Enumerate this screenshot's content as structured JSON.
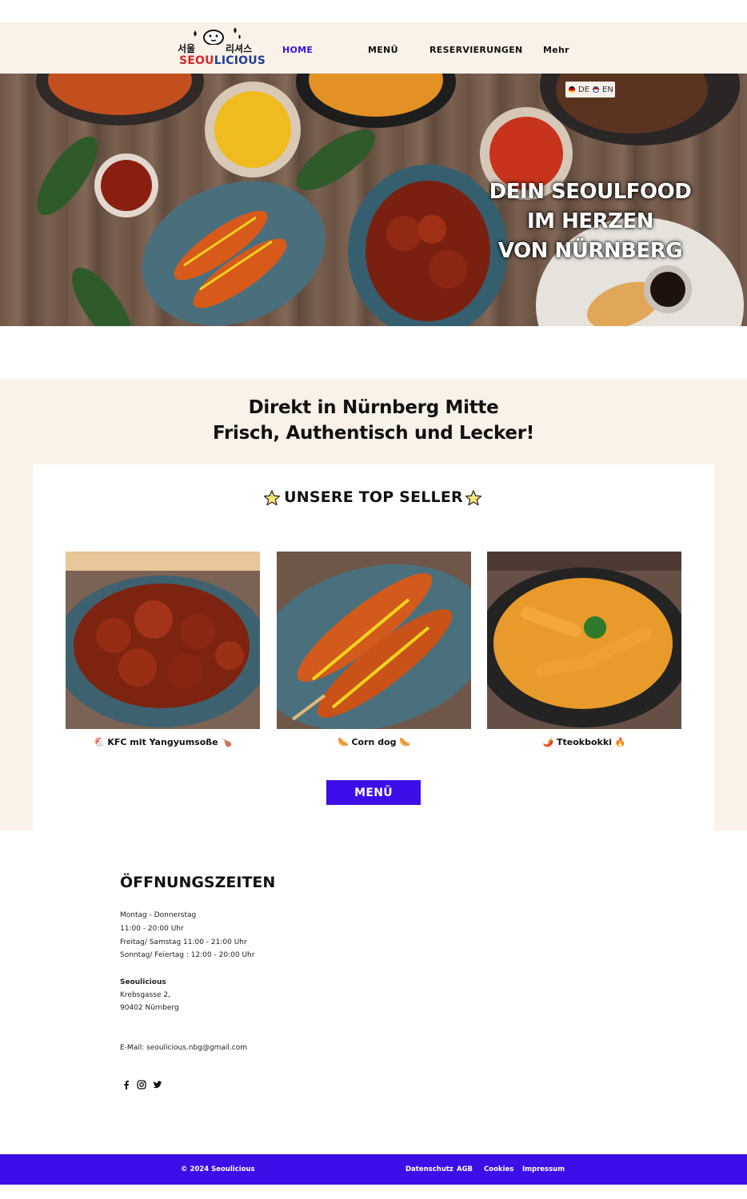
{
  "header": {
    "logo_korean_left": "서울",
    "logo_korean_right": "리셔스",
    "logo_word_red": "SEOU",
    "logo_word_blue": "LICIOUS",
    "nav": [
      {
        "label": "HOME",
        "active": true
      },
      {
        "label": "MENÜ"
      },
      {
        "label": "RESERVIERUNGEN"
      },
      {
        "label": "Mehr"
      }
    ],
    "accent_color": "#3d0ee8"
  },
  "language": {
    "de": "DE",
    "en": "EN"
  },
  "hero": {
    "lines": [
      "DEIN SEOULFOOD",
      "IM HERZEN",
      "VON NÜRNBERG"
    ]
  },
  "intro": {
    "line1": "Direkt in Nürnberg Mitte",
    "line2": "Frisch, Authentisch und Lecker!"
  },
  "top_sellers": {
    "title": "UNSERE TOP SELLER",
    "items": [
      {
        "label": "KFC mit Yangyumsoße",
        "emoji_before": "🐔",
        "emoji_after": "🍗"
      },
      {
        "label": "Corn dog",
        "emoji_before": "🌭",
        "emoji_after": "🌭"
      },
      {
        "label": "Tteokbokki",
        "emoji_before": "🌶️",
        "emoji_after": "🔥"
      }
    ],
    "button": "MENÜ"
  },
  "hours": {
    "title": "ÖFFNUNGSZEITEN",
    "lines": [
      "Montag  - Donnerstag",
      "11:00 - 20:00 Uhr",
      "Freitag/ Samstag 11:00 - 21:00 Uhr",
      "Sonntag/ Feiertag : 12:00 - 20:00 Uhr"
    ],
    "name": "Seoulicious",
    "street": "Krebsgasse 2,",
    "city": "90402 Nürnberg",
    "email": "E-Mail: seoulicious.nbg@gmail.com",
    "social": [
      "facebook-icon",
      "instagram-icon",
      "twitter-icon"
    ]
  },
  "footer": {
    "copyright": "© 2024 Seoulicious",
    "links": [
      "Datenschutz",
      "AGB",
      "Cookies",
      "Impressum"
    ]
  }
}
